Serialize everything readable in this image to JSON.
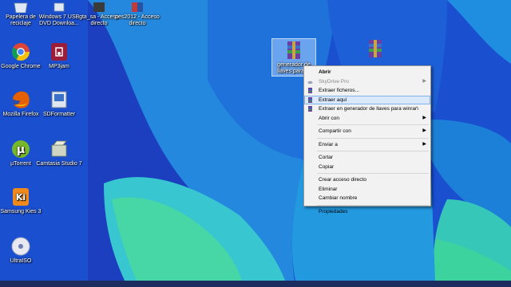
{
  "desktop": {
    "icons": [
      {
        "label": "Papelera de reciclaje",
        "icon": "recycle-bin-icon"
      },
      {
        "label": "Windows 7 USB DVD Downloa...",
        "icon": "usb-tool-icon"
      },
      {
        "label": "gta_sa - Acceso directo",
        "icon": "gta-shortcut-icon"
      },
      {
        "label": "pes2012 - Acceso directo",
        "icon": "pes-shortcut-icon"
      },
      {
        "label": "Google Chrome",
        "icon": "chrome-icon"
      },
      {
        "label": "MP3jam",
        "icon": "mp3jam-icon"
      },
      {
        "label": "Mozilla Firefox",
        "icon": "firefox-icon"
      },
      {
        "label": "SDFormatter",
        "icon": "sdformatter-icon"
      },
      {
        "label": "µTorrent",
        "icon": "utorrent-icon"
      },
      {
        "label": "Camtasia Studio 7",
        "icon": "camtasia-icon"
      },
      {
        "label": "Samsung Kies 3",
        "icon": "kies-icon"
      },
      {
        "label": "UltraISO",
        "icon": "ultraiso-icon"
      },
      {
        "label": "generador de llaves para ...",
        "icon": "winrar-archive-icon"
      },
      {
        "label": "",
        "icon": "winrar-icon"
      }
    ]
  },
  "context_menu": {
    "items": [
      {
        "label": "Abrir",
        "bold": true
      },
      {
        "label": "SkyDrive Pro",
        "disabled": true,
        "submenu": true
      },
      {
        "label": "Extraer ficheros...",
        "icon": "winrar-icon"
      },
      {
        "label": "Extraer aquí",
        "icon": "winrar-icon",
        "hover": true
      },
      {
        "label": "Extraer en generador de llaves para winrar\\",
        "icon": "winrar-icon"
      },
      {
        "label": "Abrir con",
        "submenu": true
      },
      {
        "label": "Compartir con",
        "submenu": true
      },
      {
        "label": "Enviar a",
        "submenu": true
      },
      {
        "label": "Cortar"
      },
      {
        "label": "Copiar"
      },
      {
        "label": "Crear acceso directo"
      },
      {
        "label": "Eliminar"
      },
      {
        "label": "Cambiar nombre"
      },
      {
        "label": "Propiedades"
      }
    ],
    "submenu_arrow": "▶"
  },
  "colors": {
    "wallpaper_blue": "#1a4fd0",
    "wallpaper_cyan": "#1fa6e0",
    "wallpaper_green": "#3fd3a8",
    "menu_bg": "#f2f2f2",
    "menu_hover": "#d9e8fb"
  }
}
